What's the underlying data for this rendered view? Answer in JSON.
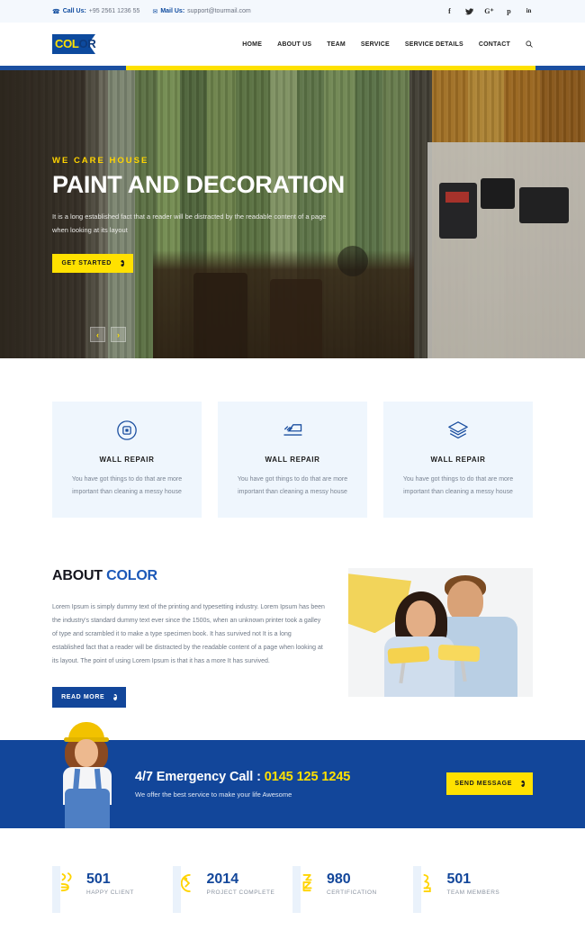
{
  "topbar": {
    "call_label": "Call Us:",
    "call_value": "+95 2561 1236 55",
    "mail_label": "Mail Us:",
    "mail_value": "support@tourmail.com",
    "socials": [
      {
        "name": "facebook-icon",
        "glyph": "f"
      },
      {
        "name": "twitter-icon",
        "glyph": "t"
      },
      {
        "name": "google-plus-icon",
        "glyph": "G+"
      },
      {
        "name": "pinterest-icon",
        "glyph": "p"
      },
      {
        "name": "linkedin-icon",
        "glyph": "in"
      }
    ]
  },
  "header": {
    "logo_part1": "COL",
    "logo_part2": "OR",
    "nav": [
      {
        "label": "HOME"
      },
      {
        "label": "ABOUT US"
      },
      {
        "label": "TEAM"
      },
      {
        "label": "SERVICE"
      },
      {
        "label": "SERVICE DETAILS"
      },
      {
        "label": "CONTACT"
      }
    ],
    "search_label": "search-icon"
  },
  "hero": {
    "kicker": "WE CARE HOUSE",
    "title": "PAINT AND DECORATION",
    "description": "It is a long established fact that a reader will be distracted by the readable content of a page when looking at its layout",
    "cta_label": "GET STARTED",
    "prev_label": "‹",
    "next_label": "›"
  },
  "services": [
    {
      "icon": "frame-square-icon",
      "title": "WALL REPAIR",
      "description": "You have got things to do that are more important than cleaning a messy house"
    },
    {
      "icon": "paint-roller-icon",
      "title": "WALL REPAIR",
      "description": "You have got things to do that are more important than cleaning a messy house"
    },
    {
      "icon": "layers-icon",
      "title": "WALL REPAIR",
      "description": "You have got things to do that are more important than cleaning a messy house"
    }
  ],
  "about": {
    "title_part1": "ABOUT ",
    "title_part2": "COLOR",
    "text": "Lorem Ipsum is simply dummy text of the printing and typesetting industry. Lorem Ipsum has been the industry's standard dummy text ever since the 1500s, when an unknown printer took a galley of type and scrambled it to make a type specimen book. It has survived not It is a long established fact that a reader will be distracted by the readable content of a page when looking at its layout. The point of using Lorem Ipsum is that it has a more It has survived.",
    "cta_label": "READ MORE",
    "image_alt": "couple-with-paint-rollers-photo"
  },
  "emergency": {
    "title_text": "4/7 Emergency Call : ",
    "phone": "0145 125 1245",
    "subtitle": "We offer the best service to make your life Awesome",
    "cta_label": "SEND MESSAGE",
    "worker_alt": "worker-woman-photo"
  },
  "counters": [
    {
      "icon": "happy-client-icon",
      "number": "501",
      "label": "HAPPY CLIENT"
    },
    {
      "icon": "project-complete-icon",
      "number": "2014",
      "label": "PROJECT COMPLETE"
    },
    {
      "icon": "certification-icon",
      "number": "980",
      "label": "CERTIFICATION"
    },
    {
      "icon": "team-members-icon",
      "number": "501",
      "label": "TEAM MEMBERS"
    }
  ],
  "colors": {
    "brand_blue": "#12469a",
    "accent_yellow": "#ffe100",
    "card_bg": "#eff6fd",
    "topbar_bg": "#f4f8fd"
  }
}
